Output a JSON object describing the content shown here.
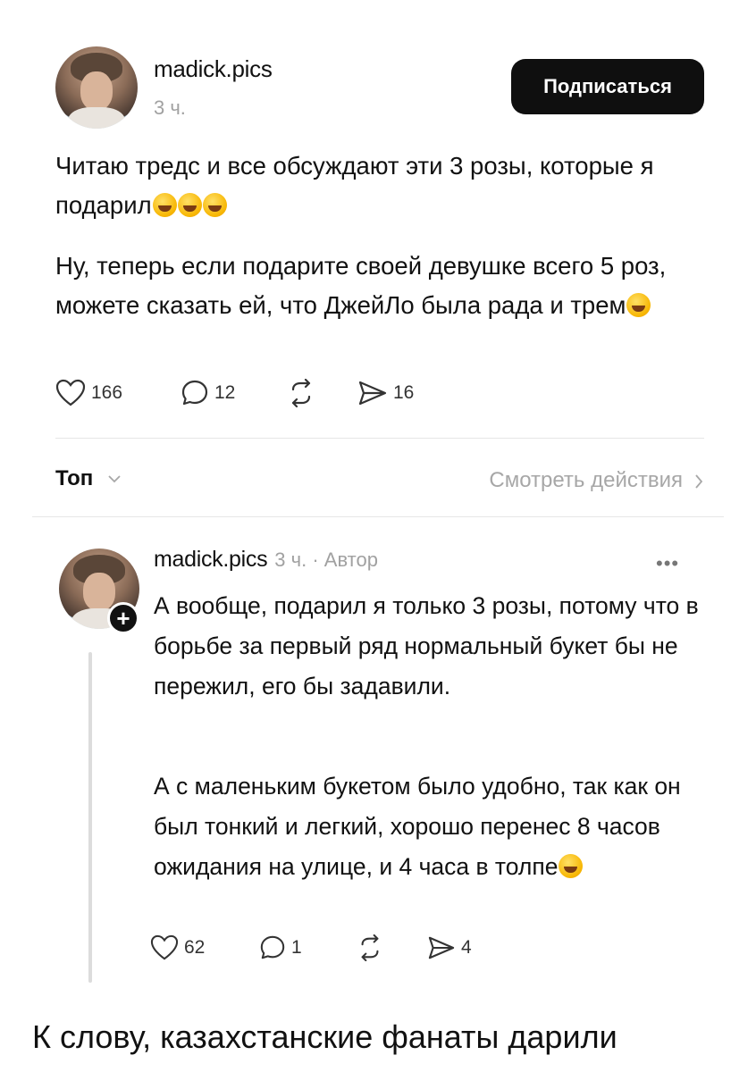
{
  "post": {
    "username": "madick.pics",
    "time": "3 ч.",
    "follow_label": "Подписаться",
    "paragraph1": "Читаю тредс и все обсуждают эти 3 розы, которые я подарил",
    "paragraph1_emoji": "rolling-on-floor-laughing",
    "paragraph2": "Ну, теперь если подарите своей девушке всего 5 роз, можете сказать ей, что ДжейЛо была рада и трем",
    "paragraph2_emoji": "tears-of-joy",
    "likes": "166",
    "comments": "12",
    "shares": "16"
  },
  "sort": {
    "label": "Топ",
    "view_activity": "Смотреть действия"
  },
  "reply": {
    "username": "madick.pics",
    "meta": "3 ч. · Автор",
    "paragraph1": "А вообще, подарил я только 3 розы, потому что в борьбе за первый ряд нормальный букет бы не пережил, его бы задавили.",
    "paragraph2": "А с маленьким букетом было удобно, так как он был тонкий и легкий, хорошо перенес 8 часов ожидания на улице, и 4 часа в толпе",
    "paragraph2_emoji": "tears-of-joy",
    "likes": "62",
    "comments": "1",
    "shares": "4"
  },
  "caption": "К слову, казахстанские фанаты дарили",
  "colors": {
    "follow_button_bg": "#0f0f0f",
    "muted_text": "#a1a1a1",
    "divider": "#e6e6e6"
  }
}
